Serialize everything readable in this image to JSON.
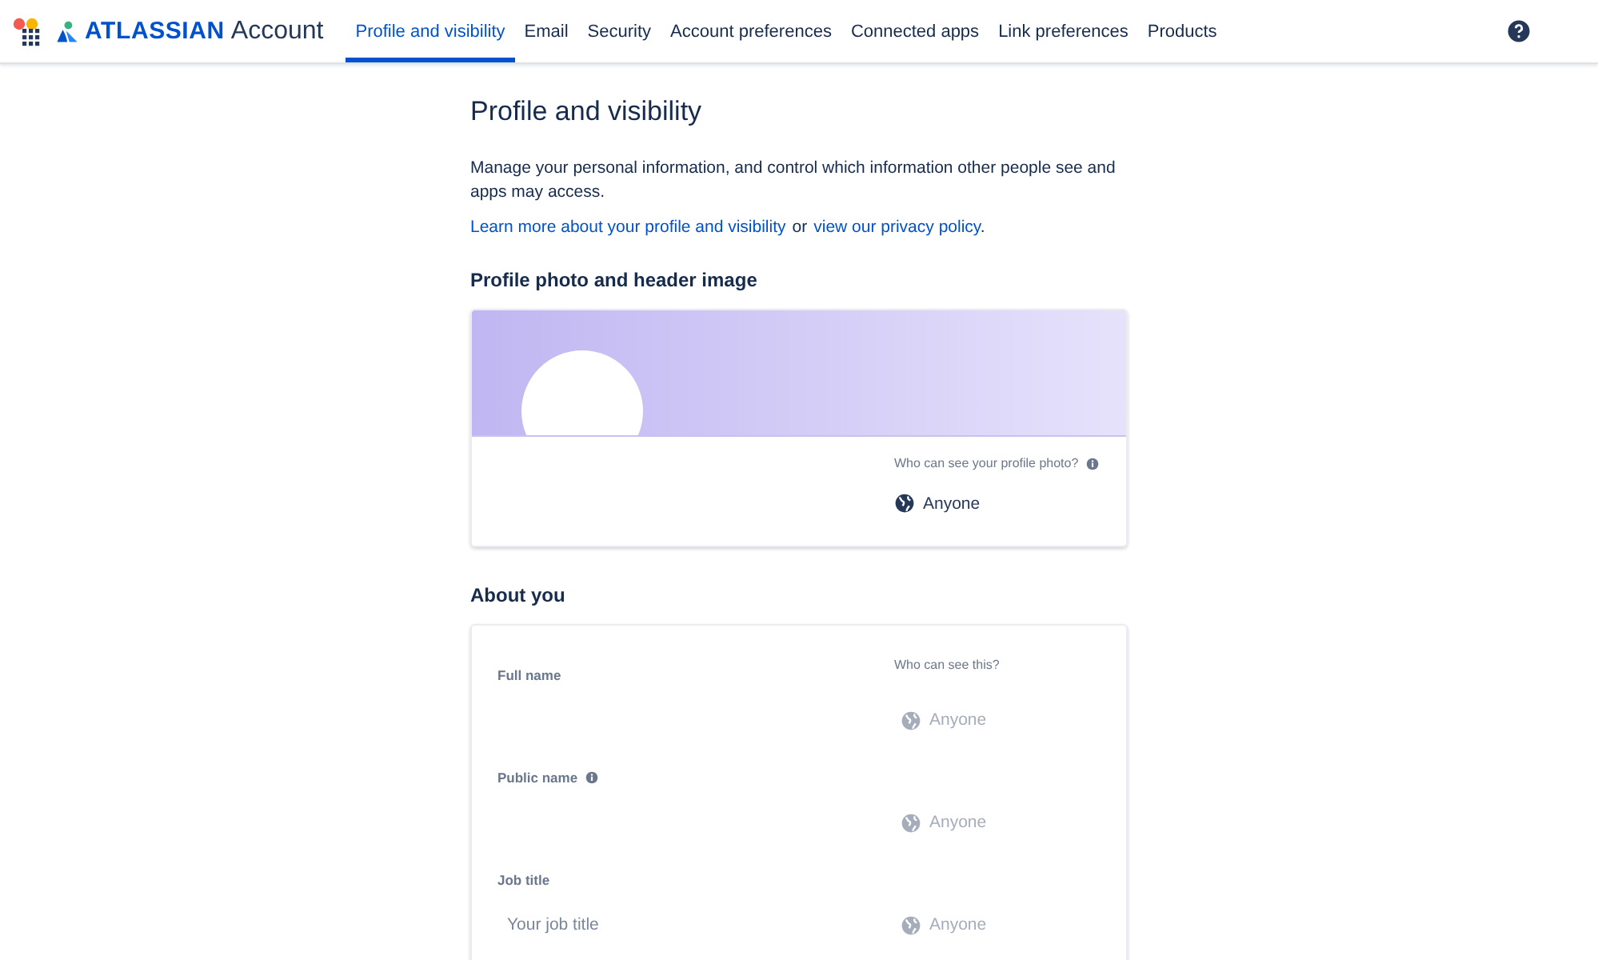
{
  "header": {
    "product": "ATLASSIAN",
    "product_suffix": "Account",
    "tabs": [
      {
        "label": "Profile and visibility",
        "selected": true
      },
      {
        "label": "Email",
        "selected": false
      },
      {
        "label": "Security",
        "selected": false
      },
      {
        "label": "Account preferences",
        "selected": false
      },
      {
        "label": "Connected apps",
        "selected": false
      },
      {
        "label": "Link preferences",
        "selected": false
      },
      {
        "label": "Products",
        "selected": false
      }
    ]
  },
  "page": {
    "title": "Profile and visibility",
    "intro": "Manage your personal information, and control which information other people see and apps may access.",
    "links": {
      "learn_more": "Learn more about your profile and visibility",
      "separator": "or",
      "privacy": "view our privacy policy",
      "end": "."
    }
  },
  "photo_section": {
    "heading": "Profile photo and header image",
    "visibility_label": "Who can see your profile photo?",
    "visibility": {
      "value": "Anyone",
      "disabled": false
    }
  },
  "about_section": {
    "heading": "About you",
    "column_label": "Who can see this?",
    "fields": [
      {
        "label": "Full name",
        "info": false,
        "visibility": {
          "value": "Anyone",
          "disabled": true
        }
      },
      {
        "label": "Public name",
        "info": true,
        "visibility": {
          "value": "Anyone",
          "disabled": true
        }
      },
      {
        "label": "Job title",
        "info": false,
        "placeholder": "Your job title",
        "visibility": {
          "value": "Anyone",
          "disabled": true
        }
      }
    ]
  }
}
